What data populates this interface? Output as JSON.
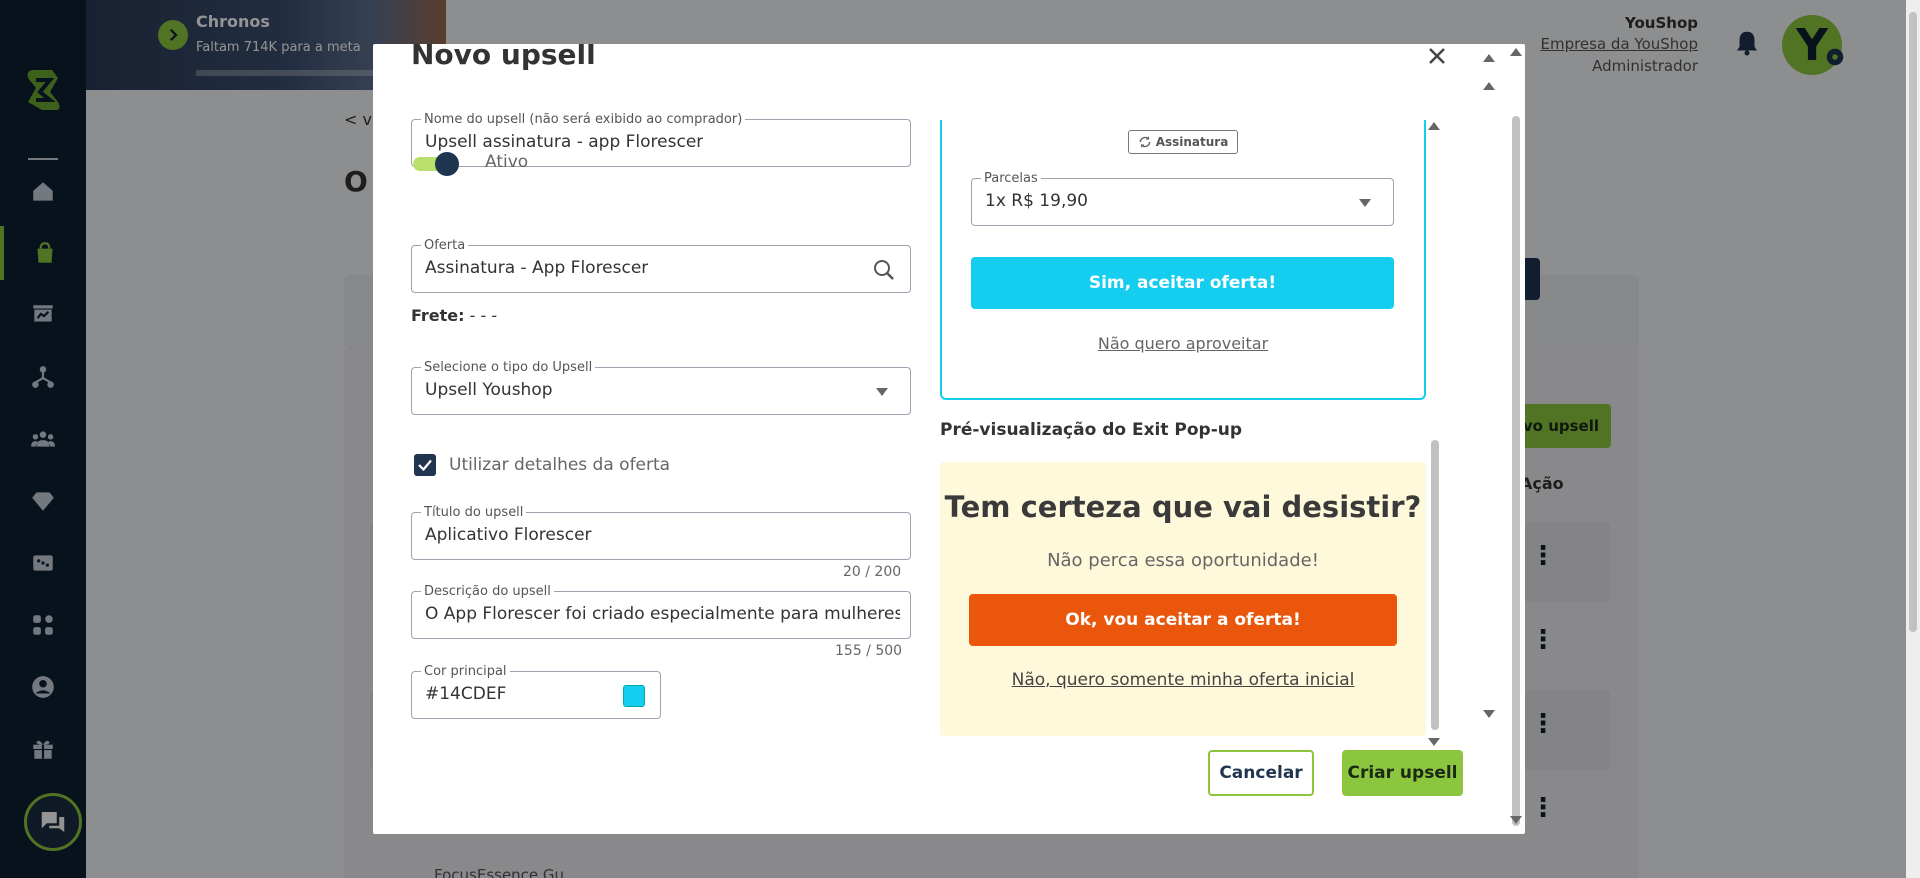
{
  "banner": {
    "title": "Chronos",
    "subtitle": "Faltam 714K para a meta"
  },
  "header": {
    "shop_name": "YouShop",
    "company": "Empresa da YouShop",
    "role": "Administrador",
    "avatar_letter": "Y"
  },
  "background": {
    "back_link": "< vo",
    "page_title": "O",
    "new_button": "vo upsell",
    "action_header": "Ação",
    "row_text": "FocusEssence Gu"
  },
  "modal": {
    "title": "Novo upsell",
    "name_field": {
      "label": "Nome do upsell (não será exibido ao comprador)",
      "value": "Upsell assinatura - app Florescer"
    },
    "active_label": "Ativo",
    "offer_field": {
      "label": "Oferta",
      "value": "Assinatura - App Florescer"
    },
    "frete_label": "Frete:",
    "frete_value": " - - -",
    "type_field": {
      "label": "Selecione o tipo do Upsell",
      "value": "Upsell Youshop"
    },
    "use_details_label": "Utilizar detalhes da oferta",
    "title_field": {
      "label": "Título do upsell",
      "value": "Aplicativo Florescer",
      "counter": "20 / 200"
    },
    "desc_field": {
      "label": "Descrição do upsell",
      "value": "O App Florescer foi criado especialmente para mulheres, o",
      "counter": "155 / 500"
    },
    "color_field": {
      "label": "Cor principal",
      "value": "#14CDEF"
    },
    "preview": {
      "badge": "Assinatura",
      "installments_label": "Parcelas",
      "installments_value": "1x R$ 19,90",
      "accept_button": "Sim, aceitar oferta!",
      "decline_link": "Não quero aproveitar"
    },
    "exit_preview": {
      "label": "Pré-visualização do Exit Pop-up",
      "title": "Tem certeza que vai desistir?",
      "subtitle": "Não perca essa oportunidade!",
      "ok_button": "Ok, vou aceitar a oferta!",
      "initial_link": "Não, quero somente minha oferta inicial"
    },
    "cancel_button": "Cancelar",
    "create_button": "Criar upsell"
  },
  "colors": {
    "primary": "#14CDEF",
    "brand_green": "#8cc63f",
    "navy": "#1f3550",
    "exit_button": "#e9560c",
    "exit_bg": "#fff9db"
  }
}
